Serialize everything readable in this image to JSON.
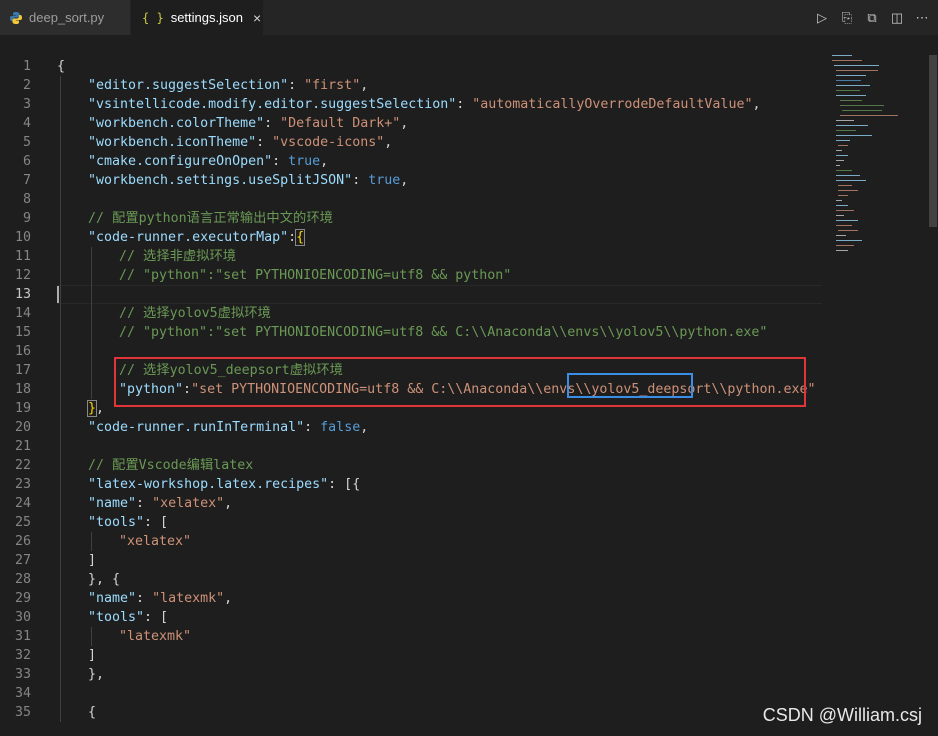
{
  "tabs": [
    {
      "label": "deep_sort.py",
      "icon": "python-icon",
      "active": false
    },
    {
      "label": "settings.json",
      "icon": "json-braces-icon",
      "active": true
    }
  ],
  "json_icon_text": "{ }",
  "close_glyph": "×",
  "editor_actions": [
    {
      "name": "run-icon",
      "glyph": "▷"
    },
    {
      "name": "open-settings-icon",
      "glyph": "⎘"
    },
    {
      "name": "compare-icon",
      "glyph": "⧉"
    },
    {
      "name": "split-editor-icon",
      "glyph": "◫"
    },
    {
      "name": "more-actions-icon",
      "glyph": "⋯"
    }
  ],
  "active_line": 13,
  "code_lines": [
    {
      "n": 1,
      "indent": 0,
      "tokens": [
        [
          "p",
          "{"
        ]
      ]
    },
    {
      "n": 2,
      "indent": 1,
      "tokens": [
        [
          "k",
          "\"editor.suggestSelection\""
        ],
        [
          "p",
          ": "
        ],
        [
          "s",
          "\"first\""
        ],
        [
          "p",
          ","
        ]
      ]
    },
    {
      "n": 3,
      "indent": 1,
      "tokens": [
        [
          "k",
          "\"vsintellicode.modify.editor.suggestSelection\""
        ],
        [
          "p",
          ": "
        ],
        [
          "s",
          "\"automaticallyOverrodeDefaultValue\""
        ],
        [
          "p",
          ","
        ]
      ]
    },
    {
      "n": 4,
      "indent": 1,
      "tokens": [
        [
          "k",
          "\"workbench.colorTheme\""
        ],
        [
          "p",
          ": "
        ],
        [
          "s",
          "\"Default Dark+\""
        ],
        [
          "p",
          ","
        ]
      ]
    },
    {
      "n": 5,
      "indent": 1,
      "tokens": [
        [
          "k",
          "\"workbench.iconTheme\""
        ],
        [
          "p",
          ": "
        ],
        [
          "s",
          "\"vscode-icons\""
        ],
        [
          "p",
          ","
        ]
      ]
    },
    {
      "n": 6,
      "indent": 1,
      "tokens": [
        [
          "k",
          "\"cmake.configureOnOpen\""
        ],
        [
          "p",
          ": "
        ],
        [
          "b",
          "true"
        ],
        [
          "p",
          ","
        ]
      ]
    },
    {
      "n": 7,
      "indent": 1,
      "tokens": [
        [
          "k",
          "\"workbench.settings.useSplitJSON\""
        ],
        [
          "p",
          ": "
        ],
        [
          "b",
          "true"
        ],
        [
          "p",
          ","
        ]
      ]
    },
    {
      "n": 8,
      "indent": 0,
      "tokens": []
    },
    {
      "n": 9,
      "indent": 1,
      "tokens": [
        [
          "c",
          "// 配置python语言正常输出中文的环境"
        ]
      ]
    },
    {
      "n": 10,
      "indent": 1,
      "tokens": [
        [
          "k",
          "\"code-runner.executorMap\""
        ],
        [
          "p",
          ":"
        ],
        [
          "cur",
          "{"
        ]
      ]
    },
    {
      "n": 11,
      "indent": 2,
      "tokens": [
        [
          "c",
          "// 选择非虚拟环境"
        ]
      ]
    },
    {
      "n": 12,
      "indent": 2,
      "tokens": [
        [
          "c",
          "// \"python\":\"set PYTHONIOENCODING=utf8 && python\""
        ]
      ]
    },
    {
      "n": 13,
      "indent": 0,
      "tokens": []
    },
    {
      "n": 14,
      "indent": 2,
      "tokens": [
        [
          "c",
          "// 选择yolov5虚拟环境"
        ]
      ]
    },
    {
      "n": 15,
      "indent": 2,
      "tokens": [
        [
          "c",
          "// \"python\":\"set PYTHONIOENCODING=utf8 && C:\\\\Anaconda\\\\envs\\\\yolov5\\\\python.exe\""
        ]
      ]
    },
    {
      "n": 16,
      "indent": 0,
      "tokens": []
    },
    {
      "n": 17,
      "indent": 2,
      "tokens": [
        [
          "c",
          "// 选择yolov5_deepsort虚拟环境"
        ]
      ]
    },
    {
      "n": 18,
      "indent": 2,
      "tokens": [
        [
          "k",
          "\"python\""
        ],
        [
          "p",
          ":"
        ],
        [
          "s",
          "\"set PYTHONIOENCODING=utf8 && C:\\\\Anaconda\\\\envs\\\\yolov5_deepsort\\\\python.exe\""
        ]
      ]
    },
    {
      "n": 19,
      "indent": 1,
      "tokens": [
        [
          "cur",
          "}"
        ],
        [
          "p",
          ","
        ]
      ]
    },
    {
      "n": 20,
      "indent": 1,
      "tokens": [
        [
          "k",
          "\"code-runner.runInTerminal\""
        ],
        [
          "p",
          ": "
        ],
        [
          "b",
          "false"
        ],
        [
          "p",
          ","
        ]
      ]
    },
    {
      "n": 21,
      "indent": 0,
      "tokens": []
    },
    {
      "n": 22,
      "indent": 1,
      "tokens": [
        [
          "c",
          "// 配置Vscode编辑latex"
        ]
      ]
    },
    {
      "n": 23,
      "indent": 1,
      "tokens": [
        [
          "k",
          "\"latex-workshop.latex.recipes\""
        ],
        [
          "p",
          ": [{"
        ]
      ]
    },
    {
      "n": 24,
      "indent": 1,
      "tokens": [
        [
          "k",
          "\"name\""
        ],
        [
          "p",
          ": "
        ],
        [
          "s",
          "\"xelatex\""
        ],
        [
          "p",
          ","
        ]
      ]
    },
    {
      "n": 25,
      "indent": 1,
      "tokens": [
        [
          "k",
          "\"tools\""
        ],
        [
          "p",
          ": ["
        ]
      ]
    },
    {
      "n": 26,
      "indent": 2,
      "tokens": [
        [
          "s",
          "\"xelatex\""
        ]
      ]
    },
    {
      "n": 27,
      "indent": 1,
      "tokens": [
        [
          "p",
          "]"
        ]
      ]
    },
    {
      "n": 28,
      "indent": 1,
      "tokens": [
        [
          "p",
          "}, {"
        ]
      ]
    },
    {
      "n": 29,
      "indent": 1,
      "tokens": [
        [
          "k",
          "\"name\""
        ],
        [
          "p",
          ": "
        ],
        [
          "s",
          "\"latexmk\""
        ],
        [
          "p",
          ","
        ]
      ]
    },
    {
      "n": 30,
      "indent": 1,
      "tokens": [
        [
          "k",
          "\"tools\""
        ],
        [
          "p",
          ": ["
        ]
      ]
    },
    {
      "n": 31,
      "indent": 2,
      "tokens": [
        [
          "s",
          "\"latexmk\""
        ]
      ]
    },
    {
      "n": 32,
      "indent": 1,
      "tokens": [
        [
          "p",
          "]"
        ]
      ]
    },
    {
      "n": 33,
      "indent": 1,
      "tokens": [
        [
          "p",
          "},"
        ]
      ]
    },
    {
      "n": 34,
      "indent": 0,
      "tokens": []
    },
    {
      "n": 35,
      "indent": 1,
      "tokens": [
        [
          "p",
          "{"
        ]
      ]
    }
  ],
  "watermark": "CSDN @William.csj",
  "colors": {
    "red_highlight": "#e0363a",
    "blue_highlight": "#3a8ee6"
  }
}
